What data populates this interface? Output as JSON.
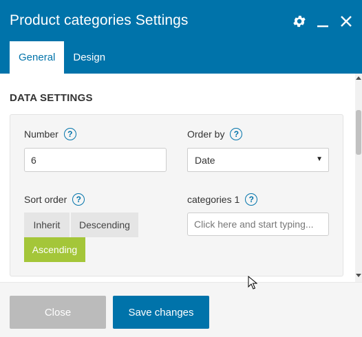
{
  "window": {
    "title": "Product categories Settings",
    "icons": [
      "gear-icon",
      "minimize-icon",
      "close-icon"
    ]
  },
  "tabs": [
    {
      "label": "General",
      "active": true
    },
    {
      "label": "Design",
      "active": false
    }
  ],
  "section": {
    "title": "DATA SETTINGS"
  },
  "fields": {
    "number": {
      "label": "Number",
      "value": "6"
    },
    "order_by": {
      "label": "Order by",
      "selected": "Date"
    },
    "sort_order": {
      "label": "Sort order",
      "options": [
        "Inherit",
        "Descending",
        "Ascending"
      ],
      "selected": "Ascending"
    },
    "categories": {
      "label": "categories 1",
      "placeholder": "Click here and start typing..."
    }
  },
  "footer": {
    "close_label": "Close",
    "save_label": "Save changes"
  },
  "colors": {
    "header": "#0073aa",
    "accent_active": "#a4c639",
    "close_button": "#bbbbbb",
    "save_button": "#0073aa"
  }
}
